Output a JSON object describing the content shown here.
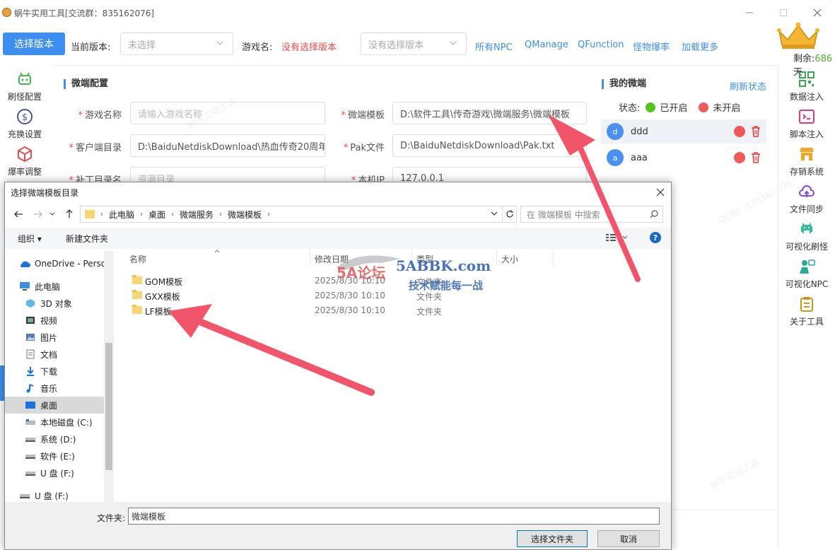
{
  "window": {
    "title": "蜗牛实用工具[交流群：835162076]",
    "minimize_icon": "minimize-icon",
    "maximize_icon": "maximize-icon",
    "close_icon": "close-icon"
  },
  "toolbar": {
    "select_version_button": "选择版本",
    "current_version_label": "当前版本:",
    "current_version_value": "未选择",
    "game_name_label": "游戏名:",
    "game_name_value": "没有选择版本",
    "version_select_value": "没有选择版本",
    "links": [
      "所有NPC",
      "QManage",
      "QFunction",
      "怪物爆率",
      "加载更多"
    ],
    "remaining_label": "剩余:",
    "remaining_value": "686",
    "remaining_unit": "天"
  },
  "left_nav": [
    {
      "label": "刷怪配置",
      "icon": "android-robot-icon"
    },
    {
      "label": "充换设置",
      "icon": "dollar-coin-icon"
    },
    {
      "label": "爆率调整",
      "icon": "box-cube-icon"
    }
  ],
  "right_nav": [
    {
      "label": "数据注入",
      "icon": "qr-code-icon"
    },
    {
      "label": "脚本注入",
      "icon": "terminal-icon"
    },
    {
      "label": "存销系统",
      "icon": "shop-icon"
    },
    {
      "label": "文件同步",
      "icon": "cloud-upload-icon"
    },
    {
      "label": "可视化刷怪",
      "icon": "space-invader-icon"
    },
    {
      "label": "可视化NPC",
      "icon": "npc-person-icon"
    },
    {
      "label": "关于工具",
      "icon": "clipboard-icon"
    }
  ],
  "config": {
    "section_title": "微端配置",
    "fields": {
      "game_name": {
        "label": "游戏名称",
        "placeholder": "请输入游戏名称"
      },
      "client_dir": {
        "label": "客户端目录",
        "value": "D:\\BaiduNetdiskDownload\\热血传奇20周年"
      },
      "patch_dir": {
        "label": "补丁目录名",
        "placeholder": "资源目录"
      },
      "micro_template": {
        "label": "微端模板",
        "value": "D:\\软件工具\\传奇游戏\\微端服务\\微端模板"
      },
      "pak_file": {
        "label": "Pak文件",
        "value": "D:\\BaiduNetdiskDownload\\Pak.txt"
      },
      "local_ip": {
        "label": "本机IP",
        "value": "127.0.0.1"
      }
    }
  },
  "my_micro": {
    "title": "我的微端",
    "refresh_link": "刷新状态",
    "status_label": "状态:",
    "status_on": "已开启",
    "status_off": "未开启",
    "colors": {
      "on": "#52c41a",
      "off": "#f05a5a"
    },
    "items": [
      {
        "avatar": "d",
        "name": "ddd"
      },
      {
        "avatar": "a",
        "name": "aaa"
      }
    ]
  },
  "watermarks": [
    "蜗牛实用工具",
    "QQ群: 835162076"
  ],
  "dialog": {
    "title": "选择微端模板目录",
    "breadcrumb": [
      "此电脑",
      "桌面",
      "微端服务",
      "微端模板"
    ],
    "search_placeholder": "在 微端模板 中搜索",
    "organize_label": "组织 ▾",
    "new_folder_label": "新建文件夹",
    "tree": [
      {
        "label": "OneDrive - Perso",
        "icon": "onedrive-cloud-icon"
      },
      {
        "label": "此电脑",
        "icon": "this-pc-icon"
      },
      {
        "label": "3D 对象",
        "icon": "3d-objects-icon"
      },
      {
        "label": "视频",
        "icon": "video-icon"
      },
      {
        "label": "图片",
        "icon": "pictures-icon"
      },
      {
        "label": "文档",
        "icon": "documents-icon"
      },
      {
        "label": "下载",
        "icon": "download-icon"
      },
      {
        "label": "音乐",
        "icon": "music-icon"
      },
      {
        "label": "桌面",
        "icon": "desktop-icon"
      },
      {
        "label": "本地磁盘 (C:)",
        "icon": "drive-icon"
      },
      {
        "label": "系统 (D:)",
        "icon": "drive-icon"
      },
      {
        "label": "软件 (E:)",
        "icon": "drive-icon"
      },
      {
        "label": "U 盘 (F:)",
        "icon": "usb-drive-icon"
      },
      {
        "label": "U 盘 (F:)",
        "icon": "usb-drive-icon"
      }
    ],
    "columns": [
      "名称",
      "修改日期",
      "类型",
      "大小"
    ],
    "files": [
      {
        "name": "GOM模板",
        "date": "2025/8/30 10:10",
        "type": "文件夹"
      },
      {
        "name": "GXX模板",
        "date": "2025/8/30 10:10",
        "type": "文件夹"
      },
      {
        "name": "LF模板",
        "date": "2025/8/30 10:10",
        "type": "文件夹"
      }
    ],
    "folder_label": "文件夹:",
    "folder_value": "微端模板",
    "select_button": "选择文件夹",
    "cancel_button": "取消"
  },
  "overlay_watermark": {
    "brand": "5A论坛",
    "site": "5ABBK.com",
    "slogan": "技术赋能每一战"
  },
  "annotation_color": "#f2546a"
}
